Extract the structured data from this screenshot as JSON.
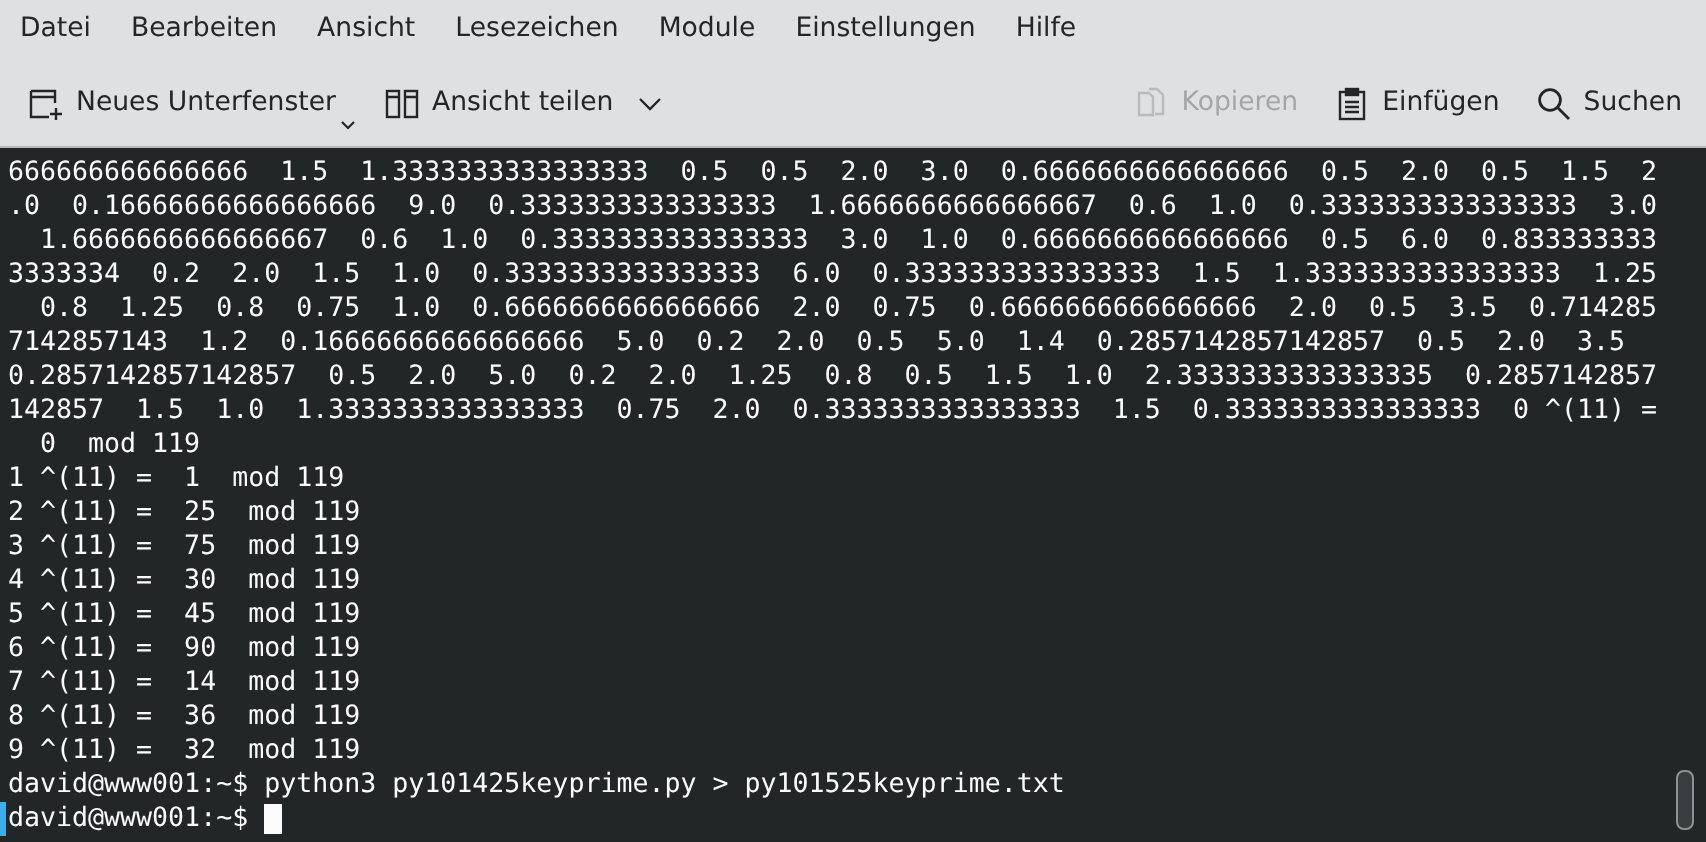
{
  "menu": [
    "Datei",
    "Bearbeiten",
    "Ansicht",
    "Lesezeichen",
    "Module",
    "Einstellungen",
    "Hilfe"
  ],
  "toolbar": {
    "left": [
      {
        "label": "Neues Unterfenster",
        "disabled": false,
        "kind": "corner"
      },
      {
        "label": "Ansicht teilen",
        "disabled": false,
        "kind": "chevron"
      }
    ],
    "right": [
      {
        "label": "Kopieren",
        "disabled": true
      },
      {
        "label": "Einfügen",
        "disabled": false
      },
      {
        "label": "Suchen",
        "disabled": false
      }
    ]
  },
  "terminal": {
    "lines": [
      "666666666666666  1.5  1.3333333333333333  0.5  0.5  2.0  3.0  0.6666666666666666  0.5  2.0  0.5  1.5  2",
      ".0  0.16666666666666666  9.0  0.3333333333333333  1.6666666666666667  0.6  1.0  0.3333333333333333  3.0",
      "  1.6666666666666667  0.6  1.0  0.3333333333333333  3.0  1.0  0.6666666666666666  0.5  6.0  0.833333333",
      "3333334  0.2  2.0  1.5  1.0  0.3333333333333333  6.0  0.3333333333333333  1.5  1.3333333333333333  1.25",
      "  0.8  1.25  0.8  0.75  1.0  0.6666666666666666  2.0  0.75  0.6666666666666666  2.0  0.5  3.5  0.714285",
      "7142857143  1.2  0.16666666666666666  5.0  0.2  2.0  0.5  5.0  1.4  0.2857142857142857  0.5  2.0  3.5",
      "0.2857142857142857  0.5  2.0  5.0  0.2  2.0  1.25  0.8  0.5  1.5  1.0  2.3333333333333335  0.2857142857",
      "142857  1.5  1.0  1.3333333333333333  0.75  2.0  0.3333333333333333  1.5  0.3333333333333333  0 ^(11) =",
      "  0  mod 119",
      "1 ^(11) =  1  mod 119",
      "2 ^(11) =  25  mod 119",
      "3 ^(11) =  75  mod 119",
      "4 ^(11) =  30  mod 119",
      "5 ^(11) =  45  mod 119",
      "6 ^(11) =  90  mod 119",
      "7 ^(11) =  14  mod 119",
      "8 ^(11) =  36  mod 119",
      "9 ^(11) =  32  mod 119",
      "david@www001:~$ python3 py101425keyprime.py > py101525keyprime.txt"
    ],
    "prompt": {
      "text": "david@www001:~$",
      "cursor": true
    }
  }
}
